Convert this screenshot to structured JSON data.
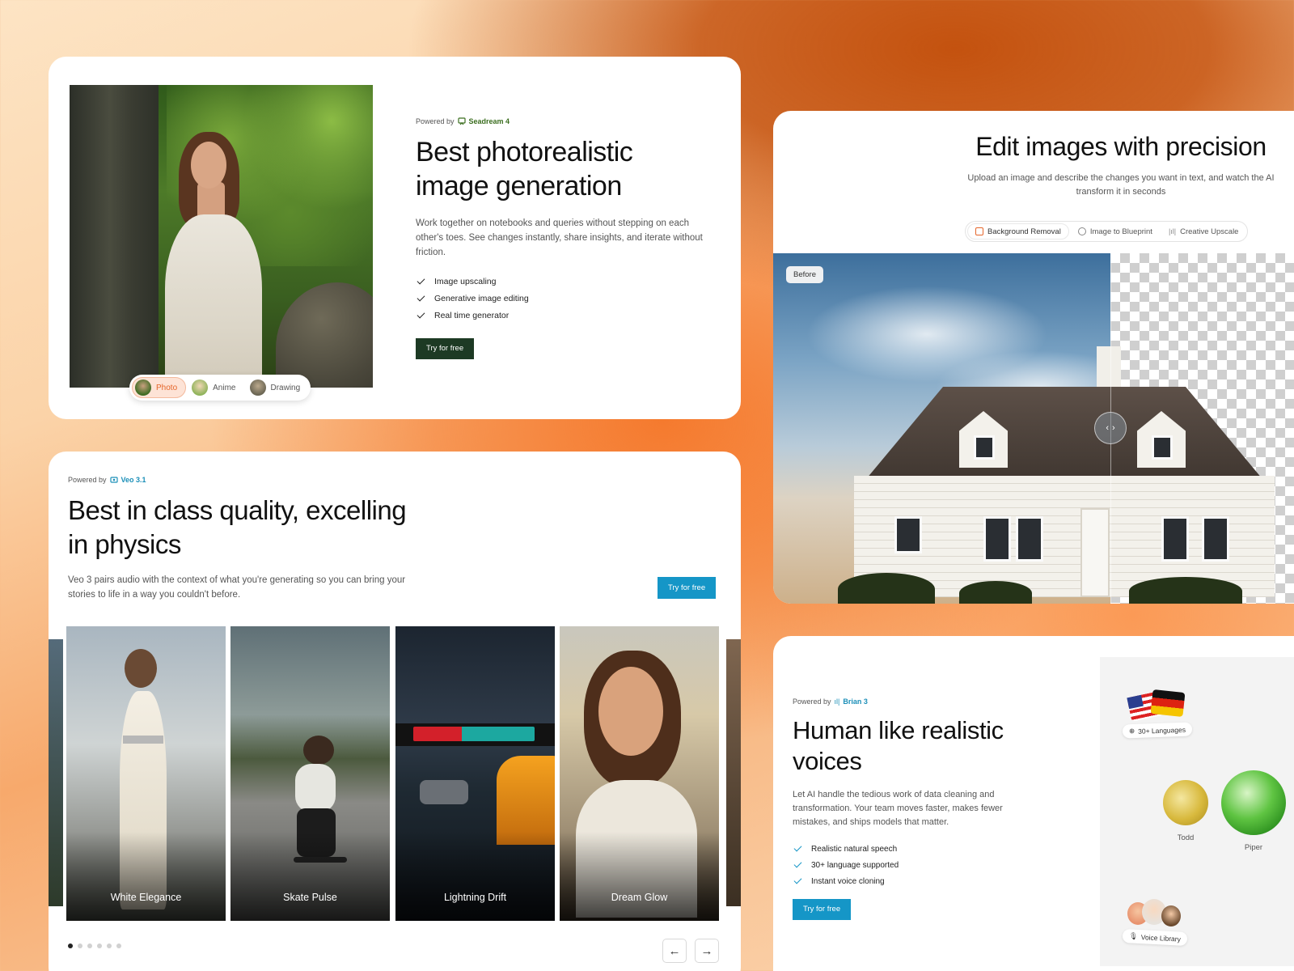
{
  "card_image_gen": {
    "powered_by_prefix": "Powered by",
    "powered_by_brand": "Seadream 4",
    "title": "Best photorealistic image generation",
    "description": "Work together on notebooks and queries without stepping on each other's toes. See changes instantly, share insights, and iterate without friction.",
    "features": [
      "Image upscaling",
      "Generative image editing",
      "Real time generator"
    ],
    "cta": "Try for free",
    "style_options": [
      "Photo",
      "Anime",
      "Drawing"
    ],
    "active_style": "Photo"
  },
  "card_edit": {
    "title": "Edit images with precision",
    "description": "Upload an image and describe the changes you want in text, and watch the AI transform it in seconds",
    "tabs": [
      "Background Removal",
      "Image to Blueprint",
      "Creative Upscale"
    ],
    "active_tab": "Background Removal",
    "before_label": "Before"
  },
  "card_video": {
    "powered_by_prefix": "Powered by",
    "powered_by_brand": "Veo 3.1",
    "title": "Best in class quality, excelling in physics",
    "description": "Veo 3 pairs audio with the context of what you're generating so you can bring your stories to life in a way you couldn't before.",
    "cta": "Try for free",
    "videos": [
      "White Elegance",
      "Skate Pulse",
      "Lightning Drift",
      "Dream Glow"
    ],
    "pagination_total": 6,
    "pagination_active": 1
  },
  "card_voice": {
    "powered_by_prefix": "Powered by",
    "powered_by_brand": "Brian 3",
    "title": "Human like realistic voices",
    "description": "Let AI handle the tedious work of data cleaning and transformation. Your team moves faster, makes fewer mistakes, and ships models that matter.",
    "features": [
      "Realistic natural speech",
      "30+ language supported",
      "Instant voice cloning"
    ],
    "cta": "Try for free",
    "languages_chip": "30+ Languages",
    "voices": [
      "Todd",
      "Piper"
    ],
    "voice_library_chip": "Voice Library"
  },
  "colors": {
    "seadream_green": "#3b6e1f",
    "dark_green_button": "#1d3a24",
    "accent_blue": "#1596c7",
    "active_pill_orange": "#e5662b"
  }
}
